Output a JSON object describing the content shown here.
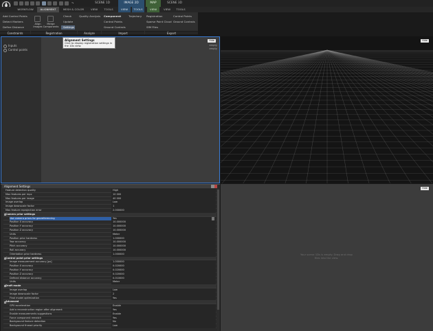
{
  "toolbar": {
    "redo_symbol": "↷",
    "quick_icons": [
      "open-icon",
      "save-icon",
      "save-as-icon",
      "layout-icon",
      "layout-alt-icon",
      "measure-icon",
      "mapping-icon",
      "camera-icon",
      "grid-icon",
      "undo-icon"
    ]
  },
  "scene_tabs": {
    "scene1": "SCENE 1D",
    "image2d": "IMAGE 2D",
    "map": "MAP",
    "scene3d": "SCENE 3D"
  },
  "menus": {
    "workflow": "WORKFLOW",
    "alignment": "ALIGNMENT",
    "mesh_color": "MESH & COLOR",
    "view1": "VIEW",
    "tools1": "TOOLS",
    "view2": "VIEW",
    "tools2": "TOOLS",
    "view3": "VIEW",
    "view4": "VIEW",
    "tools3": "TOOLS"
  },
  "ribbon": {
    "constraints": {
      "label": "Constraints",
      "items": [
        "Add Control Points",
        "Detect Markers",
        "Define Distance"
      ]
    },
    "registration": {
      "label": "Registration",
      "align_images": "Align Images",
      "merge_components": "Merge Components",
      "items": [
        "Check",
        "Update",
        "Settings"
      ]
    },
    "analyze": {
      "label": "Analyze",
      "items": [
        "Quality Analysis"
      ]
    },
    "import": {
      "label": "Import",
      "items": [
        "Component",
        "Control Points",
        "Ground Controls",
        "Trajectory"
      ]
    },
    "export": {
      "label": "Export",
      "items": [
        "Registration",
        "Sparse Point Cloud",
        "SfM Files",
        "Control Points",
        "Ground Controls"
      ]
    }
  },
  "tooltip": {
    "title": "Alignment Settings",
    "body": "Click to display registration settings in the 1Ds view."
  },
  "tree": {
    "items": [
      "Inputs",
      "Control points"
    ]
  },
  "panes": {
    "top_left": {
      "button": "Hide",
      "empty1": "empty",
      "empty2": "empty"
    },
    "top_right": {
      "button": "Hide"
    },
    "bottom_right": {
      "button": "Hide",
      "placeholder": "Your scene 1Ds is empty. Drag and drop files into the view."
    }
  },
  "settings": {
    "title": "Alignment Settings",
    "rows": [
      {
        "k": "Feature detection quality",
        "v": "High"
      },
      {
        "k": "Max features per mpx",
        "v": "10 000"
      },
      {
        "k": "Max features per image",
        "v": "40 000"
      },
      {
        "k": "Image overlap",
        "v": "Low"
      },
      {
        "k": "Image downscale factor",
        "v": "1"
      },
      {
        "k": "Max feature reprojection error",
        "v": "2.000000"
      },
      {
        "k": "Camera prior settings",
        "v": "",
        "sec": true
      },
      {
        "k": "Use camera priors for georeferencing",
        "v": "Yes",
        "sub": true,
        "sel": true
      },
      {
        "k": "Position X accuracy",
        "v": "10.000000",
        "sub": true
      },
      {
        "k": "Position Y accuracy",
        "v": "10.000000",
        "sub": true
      },
      {
        "k": "Position Z accuracy",
        "v": "10.000000",
        "sub": true
      },
      {
        "k": "Units",
        "v": "Meter",
        "sub": true
      },
      {
        "k": "Position prior hardness",
        "v": "1.000000",
        "sub": true
      },
      {
        "k": "Yaw accuracy",
        "v": "10.000000",
        "sub": true
      },
      {
        "k": "Pitch accuracy",
        "v": "10.000000",
        "sub": true
      },
      {
        "k": "Roll accuracy",
        "v": "10.000000",
        "sub": true
      },
      {
        "k": "Orientation prior hardness",
        "v": "1.000000",
        "sub": true
      },
      {
        "k": "Control point prior settings",
        "v": "",
        "sec": true
      },
      {
        "k": "Image measurement accuracy [px]",
        "v": "1.000000",
        "sub": true
      },
      {
        "k": "Position X accuracy",
        "v": "0.020000",
        "sub": true
      },
      {
        "k": "Position Y accuracy",
        "v": "0.020000",
        "sub": true
      },
      {
        "k": "Position Z accuracy",
        "v": "0.020000",
        "sub": true
      },
      {
        "k": "Defined distance accuracy",
        "v": "0.010000",
        "sub": true
      },
      {
        "k": "Units",
        "v": "Meter",
        "sub": true
      },
      {
        "k": "Draft mode",
        "v": "",
        "sec": true
      },
      {
        "k": "Image overlap",
        "v": "Low",
        "sub": true
      },
      {
        "k": "Image downscale factor",
        "v": "2",
        "sub": true
      },
      {
        "k": "Final model optimization",
        "v": "Yes",
        "sub": true
      },
      {
        "k": "Advanced",
        "v": "",
        "sec": true
      },
      {
        "k": "GPU acceleration",
        "v": "Enable",
        "sub": true
      },
      {
        "k": "Add a reconstruction region after alignment",
        "v": "Yes",
        "sub": true
      },
      {
        "k": "Enable measurements suggestions",
        "v": "Enable",
        "sub": true
      },
      {
        "k": "Force component rematch",
        "v": "Yes",
        "sub": true
      },
      {
        "k": "Background feature detection",
        "v": "No",
        "sub": true
      },
      {
        "k": "Background thread priority",
        "v": "Low",
        "sub": true
      }
    ]
  },
  "colors": {
    "selection": "#2f5fa5",
    "active_pane": "#3a7bd5",
    "image2d_tab": "#2c4e6e",
    "map_tab": "#3f6138"
  }
}
